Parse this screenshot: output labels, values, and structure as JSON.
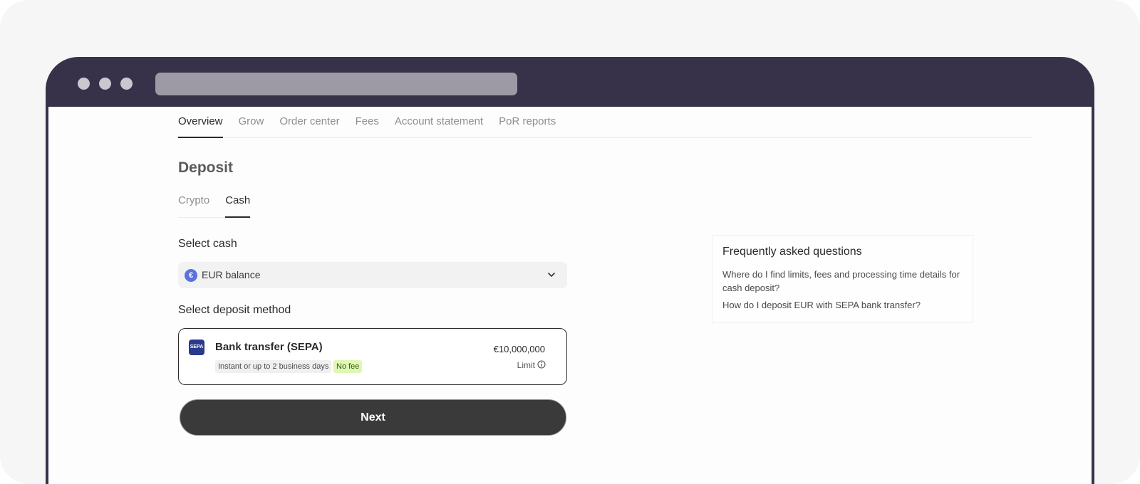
{
  "nav": {
    "tabs": [
      {
        "label": "Overview",
        "active": true
      },
      {
        "label": "Grow"
      },
      {
        "label": "Order center"
      },
      {
        "label": "Fees"
      },
      {
        "label": "Account statement"
      },
      {
        "label": "PoR reports"
      }
    ]
  },
  "page": {
    "title": "Deposit"
  },
  "subtabs": [
    {
      "label": "Crypto"
    },
    {
      "label": "Cash",
      "active": true
    }
  ],
  "select_cash": {
    "label": "Select cash",
    "currency_symbol": "€",
    "value": "EUR balance",
    "icon": "chevron-down-icon"
  },
  "deposit_method": {
    "label": "Select deposit method",
    "logo_text": "SEPA",
    "name": "Bank transfer (SEPA)",
    "time": "Instant or up to 2 business days",
    "fee": "No fee",
    "limit_amount": "€10,000,000",
    "limit_label": "Limit",
    "icon": "info-icon"
  },
  "actions": {
    "next_label": "Next"
  },
  "faq": {
    "title": "Frequently asked questions",
    "questions": [
      "Where do I find limits, fees and processing time details for cash deposit?",
      "How do I deposit EUR with SEPA bank transfer?"
    ]
  },
  "colors": {
    "browser_chrome": "#37324a",
    "accent_dark": "#3a3a3a",
    "fee_badge": "#dff7b5",
    "euro_badge": "#5b72e0"
  }
}
